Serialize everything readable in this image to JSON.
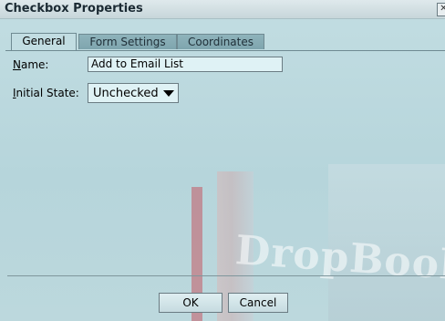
{
  "window": {
    "title": "Checkbox Properties",
    "close_glyph": "✕"
  },
  "tabs": [
    {
      "label": "General",
      "active": true
    },
    {
      "label": "Form Settings",
      "active": false
    },
    {
      "label": "Coordinates",
      "active": false
    }
  ],
  "form": {
    "name": {
      "label_accel": "N",
      "label_rest": "ame:",
      "value": "Add to Email List"
    },
    "initial_state": {
      "label_accel": "I",
      "label_rest": "nitial State:",
      "value": "Unchecked"
    }
  },
  "buttons": {
    "ok_label": "OK",
    "cancel_label": "Cancel"
  },
  "colors": {
    "tab_active": "#c2dde2",
    "tab_inactive": "#8fb3bb",
    "input_bg": "#dff2f5"
  },
  "icons": {
    "close": "close-icon",
    "dropdown": "chevron-down-icon"
  }
}
